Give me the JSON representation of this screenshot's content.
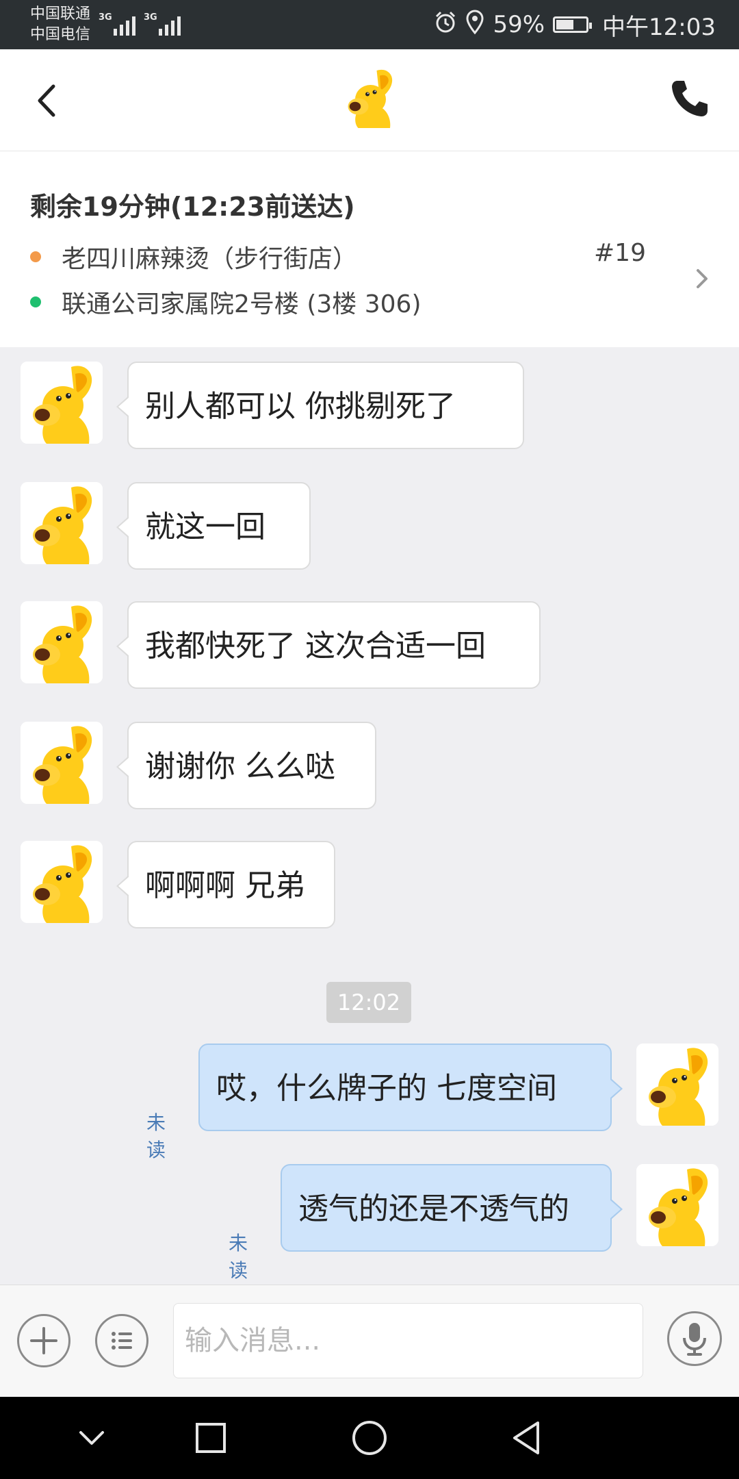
{
  "status_bar": {
    "carrier_1": "中国联通",
    "carrier_2": "中国电信",
    "network_1": "3G",
    "network_2": "3G",
    "battery": "59%",
    "battery_level": 0.59,
    "time": "中午12:03",
    "icons": [
      "alarm-icon",
      "location-icon",
      "battery-icon"
    ]
  },
  "header": {
    "icons": [
      "back-arrow-icon",
      "kangaroo-avatar",
      "phone-icon"
    ]
  },
  "order": {
    "title": "剩余19分钟(12:23前送达)",
    "store": "老四川麻辣烫（步行街店）",
    "address": "联通公司家属院2号楼 (3楼 306)",
    "number": "#19",
    "colors": {
      "store_dot": "#f39a4a",
      "address_dot": "#1fbf6f"
    }
  },
  "messages": [
    {
      "direction": "in",
      "text": "别人都可以  你挑剔死了"
    },
    {
      "direction": "in",
      "text": "就这一回"
    },
    {
      "direction": "in",
      "text": "我都快死了  这次合适一回"
    },
    {
      "direction": "in",
      "text": "谢谢你 么么哒"
    },
    {
      "direction": "in",
      "text": "啊啊啊 兄弟"
    },
    {
      "direction": "out",
      "text": "哎，什么牌子的  七度空间",
      "status": "未读"
    },
    {
      "direction": "out",
      "text": "透气的还是不透气的",
      "status": "未读"
    }
  ],
  "timestamp": "12:02",
  "input": {
    "placeholder": "输入消息...",
    "icons": [
      "plus-icon",
      "menu-icon",
      "microphone-icon"
    ]
  },
  "nav": {
    "icons": [
      "collapse-icon",
      "recent-apps-icon",
      "home-icon",
      "back-icon"
    ]
  },
  "colors": {
    "outgoing_bubble": "#cfe4fb",
    "incoming_bubble": "#ffffff",
    "unread_text": "#4a7bb6",
    "chat_background": "#efeff2"
  }
}
